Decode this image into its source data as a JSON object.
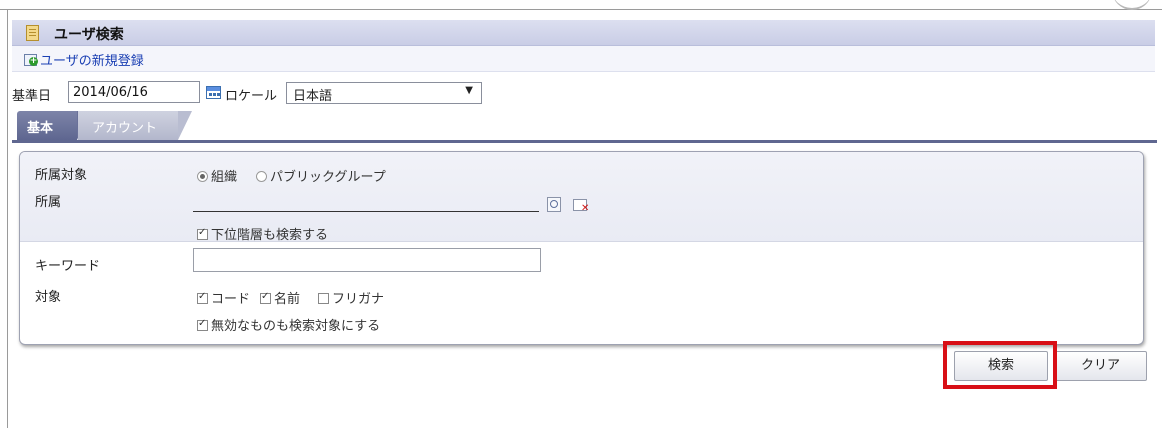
{
  "header": {
    "title": "ユーザ検索"
  },
  "subbar": {
    "add_user_link": "ユーザの新規登録"
  },
  "date_row": {
    "date_label": "基準日",
    "date_value": "2014/06/16",
    "locale_label": "ロケール",
    "locale_value": "日本語",
    "locale_arrow": "▼"
  },
  "tabs": [
    {
      "label": "基本",
      "active": true
    },
    {
      "label": "アカウント",
      "active": false
    }
  ],
  "form": {
    "target_type_label": "所属対象",
    "target_type_options": [
      {
        "label": "組織",
        "selected": true
      },
      {
        "label": "パブリックグループ",
        "selected": false
      }
    ],
    "org_label": "所属",
    "org_value": "",
    "include_sub_label": "下位階層も検索する",
    "include_sub_checked": true,
    "keyword_label": "キーワード",
    "keyword_value": "",
    "target_label": "対象",
    "target_options": [
      {
        "label": "コード",
        "checked": true
      },
      {
        "label": "名前",
        "checked": true
      },
      {
        "label": "フリガナ",
        "checked": false
      }
    ],
    "include_invalid_label": "無効なものも検索対象にする",
    "include_invalid_checked": true
  },
  "buttons": {
    "search": "検索",
    "clear": "クリア"
  },
  "colors": {
    "highlight": "#d80f16",
    "tab_active": "#5e6690",
    "link": "#1a3fb3"
  }
}
